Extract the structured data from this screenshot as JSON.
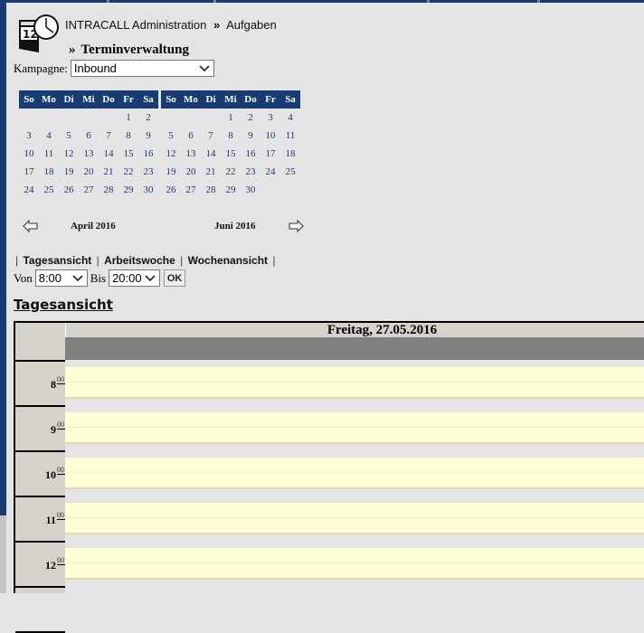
{
  "header": {
    "app_icon": "calendar-clock-icon",
    "breadcrumb": {
      "root": "INTRACALL Administration",
      "separator": "»",
      "current": "Aufgaben"
    },
    "page_title": "Terminverwaltung",
    "page_title_prefix": "»"
  },
  "campaign": {
    "label": "Kampagne:",
    "value": "Inbound"
  },
  "calendars": [
    {
      "month": "April 2016",
      "weekdays": [
        "So",
        "Mo",
        "Di",
        "Mi",
        "Do",
        "Fr",
        "Sa"
      ],
      "weeks": [
        [
          "",
          "",
          "",
          "",
          "",
          "1",
          "2"
        ],
        [
          "3",
          "4",
          "5",
          "6",
          "7",
          "8",
          "9"
        ],
        [
          "10",
          "11",
          "12",
          "13",
          "14",
          "15",
          "16"
        ],
        [
          "17",
          "18",
          "19",
          "20",
          "21",
          "22",
          "23"
        ],
        [
          "24",
          "25",
          "26",
          "27",
          "28",
          "29",
          "30"
        ]
      ]
    },
    {
      "month": "Juni 2016",
      "weekdays": [
        "So",
        "Mo",
        "Di",
        "Mi",
        "Do",
        "Fr",
        "Sa"
      ],
      "weeks": [
        [
          "",
          "",
          "",
          "1",
          "2",
          "3",
          "4"
        ],
        [
          "5",
          "6",
          "7",
          "8",
          "9",
          "10",
          "11"
        ],
        [
          "12",
          "13",
          "14",
          "15",
          "16",
          "17",
          "18"
        ],
        [
          "19",
          "20",
          "21",
          "22",
          "23",
          "24",
          "25"
        ],
        [
          "26",
          "27",
          "28",
          "29",
          "30",
          "",
          ""
        ]
      ]
    }
  ],
  "month_nav": {
    "prev_label": "April 2016",
    "next_label": "Juni 2016",
    "prev_icon": "arrow-left-icon",
    "next_icon": "arrow-right-icon"
  },
  "view_tabs": [
    "Tagesansicht",
    "Arbeitswoche",
    "Wochenansicht"
  ],
  "time_filter": {
    "from_label": "Von",
    "from_value": "8:00",
    "to_label": "Bis",
    "to_value": "20:00",
    "ok_label": "OK"
  },
  "day_view": {
    "heading": "Tagesansicht",
    "date": "Freitag, 27.05.2016",
    "hours": [
      {
        "hour": "8",
        "min": "00"
      },
      {
        "hour": "9",
        "min": "00"
      },
      {
        "hour": "10",
        "min": "00"
      },
      {
        "hour": "11",
        "min": "00"
      },
      {
        "hour": "12",
        "min": "00"
      }
    ]
  },
  "colors": {
    "primary": "#163c72",
    "slot": "#ffffd5",
    "allday": "#808080",
    "time_col": "#d5d1cb"
  }
}
